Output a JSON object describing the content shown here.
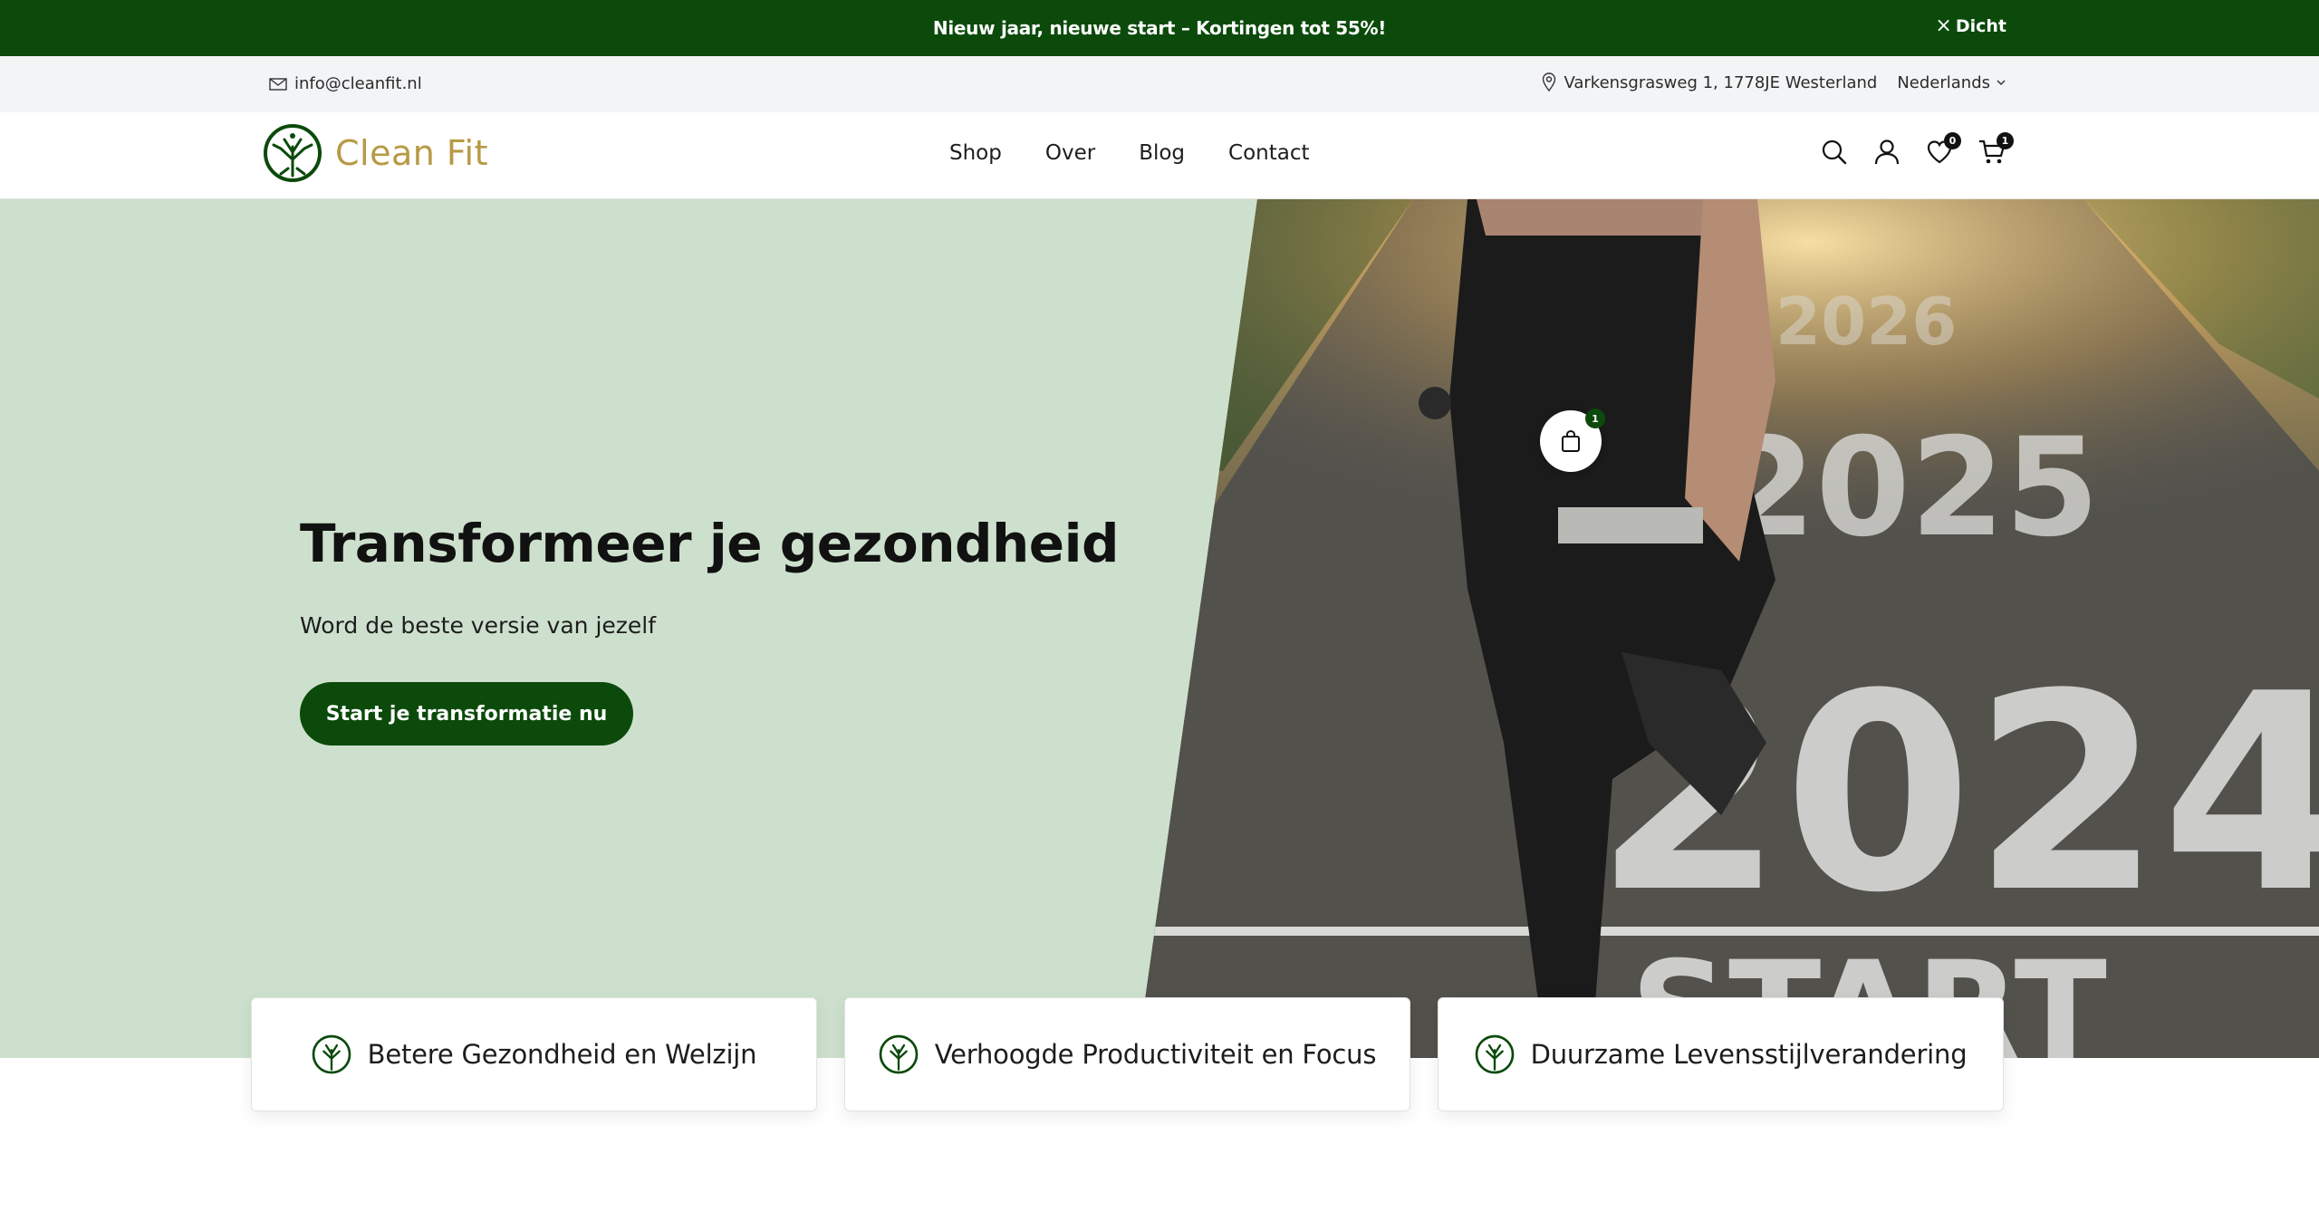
{
  "announcement": {
    "text": "Nieuw jaar, nieuwe start – Kortingen tot 55%!",
    "close_label": "Dicht"
  },
  "utility": {
    "email": "info@cleanfit.nl",
    "address": "Varkensgrasweg 1, 1778JE Westerland",
    "language": "Nederlands"
  },
  "brand": {
    "name": "Clean Fit"
  },
  "nav": {
    "links": [
      "Shop",
      "Over",
      "Blog",
      "Contact"
    ]
  },
  "header_icons": {
    "wishlist_count": "0",
    "cart_count": "1"
  },
  "hero": {
    "title": "Transformeer je gezondheid",
    "subtitle": "Word de beste versie van jezelf",
    "cta": "Start je transformatie nu",
    "hotspot_count": "1"
  },
  "features": [
    {
      "label": "Betere Gezondheid en Welzijn"
    },
    {
      "label": "Verhoogde Productiviteit en Focus"
    },
    {
      "label": "Duurzame Levensstijlverandering"
    }
  ],
  "colors": {
    "brand_green": "#0b4a0b",
    "hero_bg": "#cde0cd",
    "logo_gold": "#b79a45"
  },
  "icons": [
    "close-icon",
    "mail-icon",
    "location-pin-icon",
    "chevron-down-icon",
    "tree-logo-icon",
    "search-icon",
    "user-icon",
    "heart-icon",
    "cart-icon",
    "shopping-bag-icon"
  ]
}
